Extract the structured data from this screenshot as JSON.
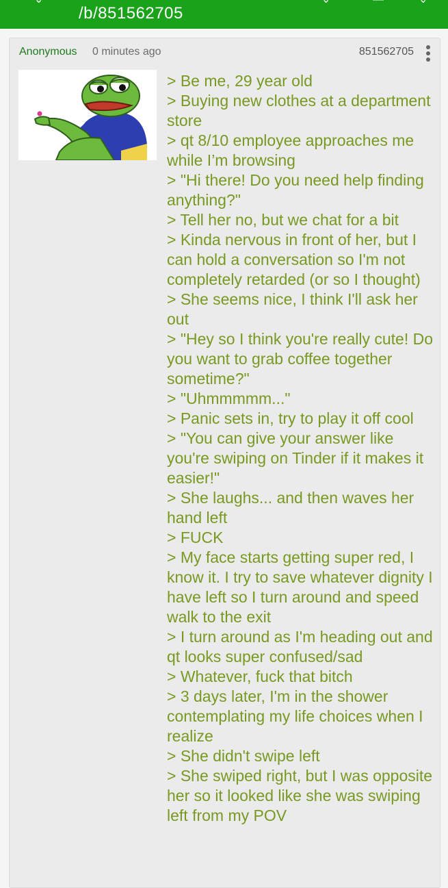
{
  "appbar": {
    "title": "/b/851562705",
    "color": "#1aa21a"
  },
  "post": {
    "name": "Anonymous",
    "time": "0 minutes ago",
    "number": "851562705",
    "thumbnail_icon": "pepe-frog-thumbnail",
    "greentext_color": "#789922",
    "lines": [
      "> Be me, 29 year old",
      "> Buying new clothes at a department store",
      "> qt 8/10 employee approaches me while I’m browsing",
      "> \"Hi there! Do you need help finding anything?\"",
      "> Tell her no, but we chat for a bit",
      "> Kinda nervous in front of her, but I can hold a conversation so I'm not completely retarded (or so I thought)",
      "> She seems nice, I think I'll ask her out",
      "> \"Hey so I think you're really cute! Do you want to grab coffee together sometime?\"",
      "> \"Uhmmmmm...\"",
      "> Panic sets in, try to play it off cool",
      "> \"You can give your answer like you're swiping on Tinder if it makes it easier!\"",
      "> She laughs... and then waves her hand left",
      "> FUCK",
      "> My face starts getting super red, I know it. I try to save whatever dignity I have left so I turn around and speed walk to the exit",
      "> I turn around as I'm heading out and qt looks super confused/sad",
      "> Whatever, fuck that bitch",
      "> 3 days later, I'm in the shower contemplating my life choices when I realize",
      "> She didn't swipe left",
      "> She swiped right, but I was opposite her so it looked like she was swiping left from my POV"
    ]
  }
}
